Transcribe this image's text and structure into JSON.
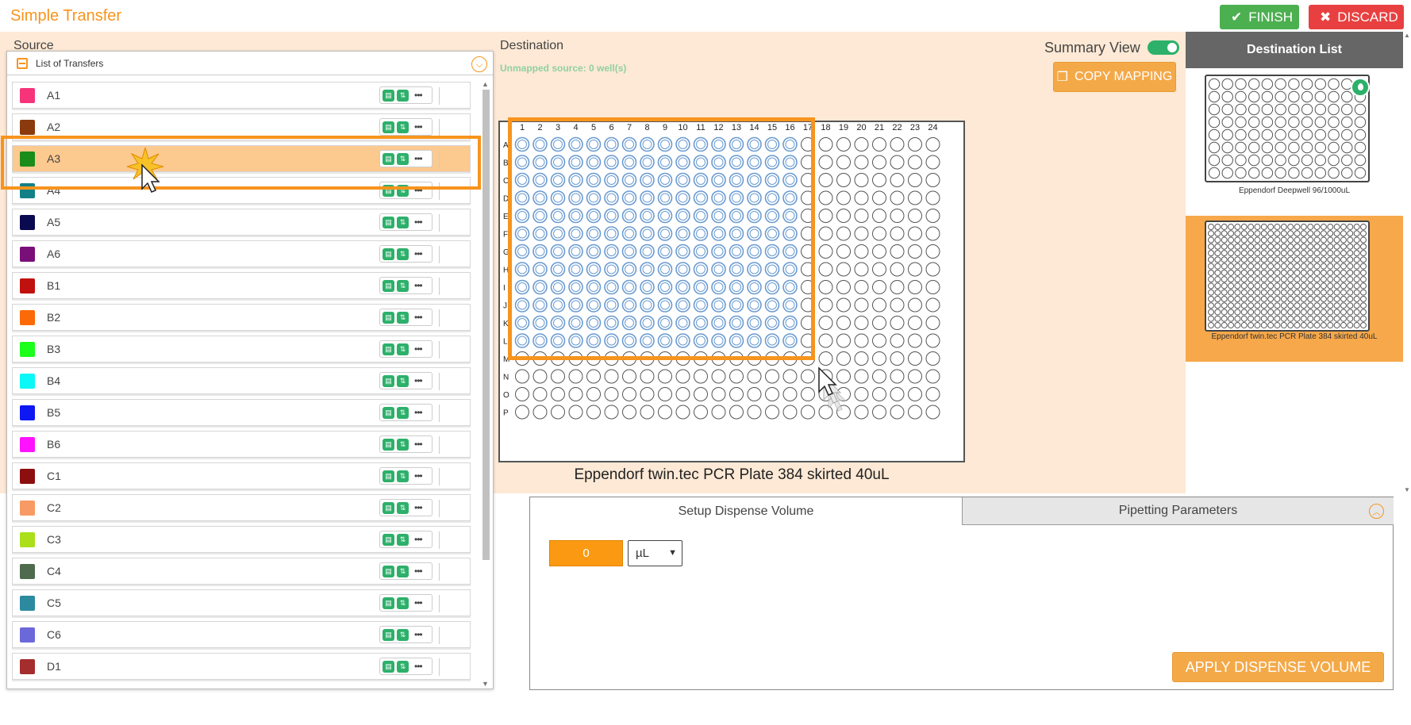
{
  "app": {
    "title": "Simple Transfer"
  },
  "header": {
    "finish_label": "FINISH",
    "discard_label": "DISCARD"
  },
  "source": {
    "label": "Source",
    "list_title": "List of Transfers",
    "items": [
      {
        "label": "A1",
        "color": "#f7347a"
      },
      {
        "label": "A2",
        "color": "#8b3a0e"
      },
      {
        "label": "A3",
        "color": "#1a8c1a"
      },
      {
        "label": "A4",
        "color": "#128087"
      },
      {
        "label": "A5",
        "color": "#0a0a50"
      },
      {
        "label": "A6",
        "color": "#7a0f7a"
      },
      {
        "label": "B1",
        "color": "#c0110f"
      },
      {
        "label": "B2",
        "color": "#fb6a07"
      },
      {
        "label": "B3",
        "color": "#1bff1b"
      },
      {
        "label": "B4",
        "color": "#0cf7f7"
      },
      {
        "label": "B5",
        "color": "#0d18f2"
      },
      {
        "label": "B6",
        "color": "#ff12ff"
      },
      {
        "label": "C1",
        "color": "#8d0e0e"
      },
      {
        "label": "C2",
        "color": "#f89a63"
      },
      {
        "label": "C3",
        "color": "#aadf1a"
      },
      {
        "label": "C4",
        "color": "#4e6b4e"
      },
      {
        "label": "C5",
        "color": "#2b8aa0"
      },
      {
        "label": "C6",
        "color": "#6b68d9"
      },
      {
        "label": "D1",
        "color": "#a52d2d"
      }
    ],
    "selected_index": 2
  },
  "destination": {
    "label": "Destination",
    "unmapped_text": "Unmapped source: 0 well(s)",
    "summary_view_label": "Summary View",
    "summary_view_on": true,
    "copy_mapping_label": "COPY MAPPING",
    "plate_name": "Eppendorf twin.tec PCR Plate 384 skirted 40uL",
    "column_labels": [
      "1",
      "2",
      "3",
      "4",
      "5",
      "6",
      "7",
      "8",
      "9",
      "10",
      "11",
      "12",
      "13",
      "14",
      "15",
      "16",
      "17",
      "18",
      "19",
      "20",
      "21",
      "22",
      "23",
      "24"
    ],
    "row_labels": [
      "A",
      "B",
      "C",
      "D",
      "E",
      "F",
      "G",
      "H",
      "I",
      "J",
      "K",
      "L",
      "M",
      "N",
      "O",
      "P"
    ],
    "mapped_columns": 16,
    "mapped_rows": 12,
    "mapped_color": "#6b9bd1"
  },
  "destination_list": {
    "title": "Destination List",
    "plates": [
      {
        "name": "Eppendorf Deepwell 96/1000uL",
        "selected": false
      },
      {
        "name": "Eppendorf twin.tec PCR Plate 384 skirted 40uL",
        "selected": true
      }
    ]
  },
  "dispense": {
    "tabs": [
      "Setup Dispense Volume",
      "Pipetting Parameters"
    ],
    "volume_value": "0",
    "unit": "µL",
    "apply_label": "APPLY DISPENSE VOLUME"
  },
  "colors": {
    "accent": "#f7941d",
    "success": "#4caf50",
    "danger": "#e84040",
    "work_bg": "#fde9d5"
  }
}
